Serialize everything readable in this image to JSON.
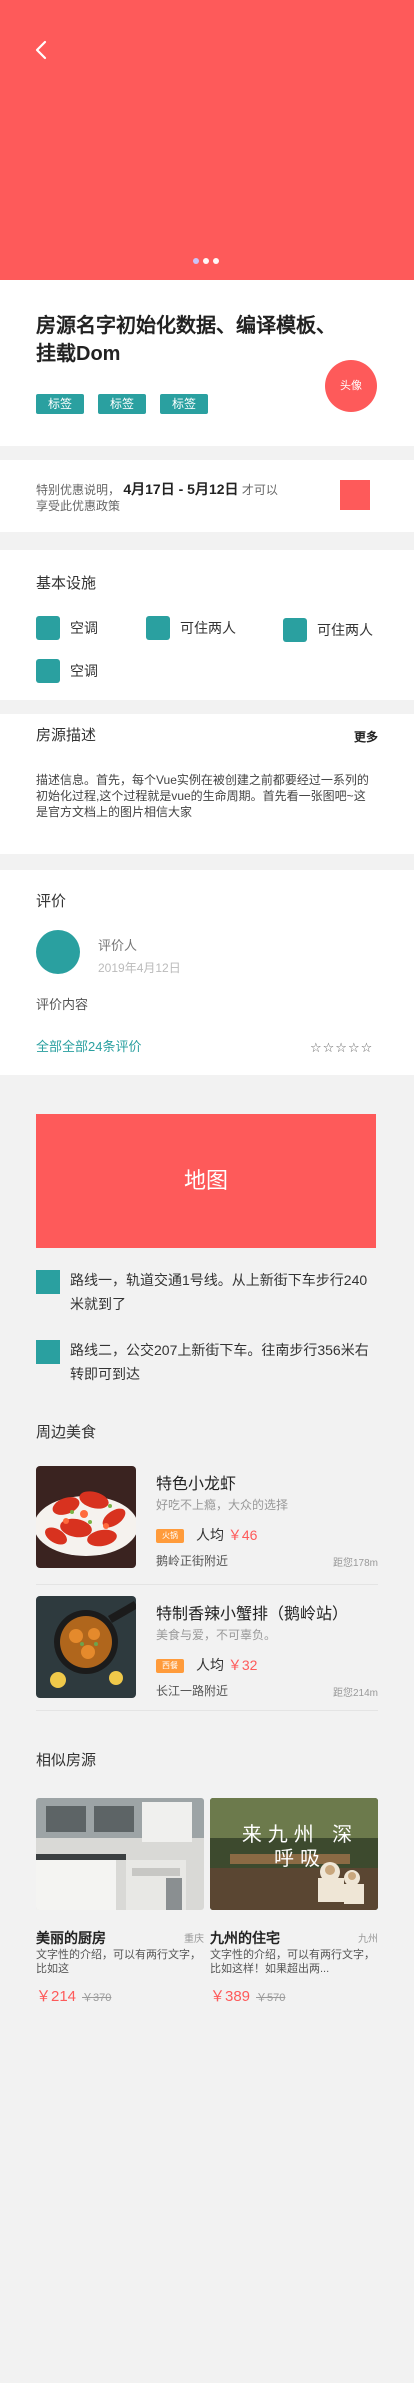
{
  "header": {
    "back_icon": "chevron-left-icon",
    "carousel": {
      "count": 3,
      "active": 0
    }
  },
  "room": {
    "title": "房源名字初始化数据、编译模板、挂载Dom",
    "tags": [
      "标签",
      "标签",
      "标签"
    ],
    "host_avatar_label": "头像"
  },
  "promo": {
    "prefix": "特别优惠说明，",
    "dates": "4月17日 - 5月12日",
    "suffix": "才可以享受此优惠政策"
  },
  "facilities": {
    "title": "基本设施",
    "items": [
      "空调",
      "可住两人",
      "可住两人",
      "空调"
    ]
  },
  "description": {
    "title": "房源描述",
    "more": "更多",
    "text": "描述信息。首先，每个Vue实例在被创建之前都要经过一系列的初始化过程,这个过程就是vue的生命周期。首先看一张图吧~这是官方文档上的图片相信大家"
  },
  "reviews": {
    "title": "评价",
    "reviewer": "评价人",
    "date": "2019年4月12日",
    "content": "评价内容",
    "all_link": "全部全部24条评价",
    "stars": "☆☆☆☆☆"
  },
  "map": {
    "label": "地图",
    "routes": [
      "路线一，轨道交通1号线。从上新街下车步行240米就到了",
      "路线二，公交207上新街下车。往南步行356米右转即可到达"
    ]
  },
  "food": {
    "title": "周边美食",
    "items": [
      {
        "name": "特色小龙虾",
        "sub": "好吃不上瘾，大众的选择",
        "badge": "火锅",
        "price_label": "人均",
        "price": "￥46",
        "addr": "鹅岭正街附近",
        "dist": "距您178m"
      },
      {
        "name": "特制香辣小蟹排（鹅岭站）",
        "sub": "美食与爱，不可辜负。",
        "badge": "西餐",
        "price_label": "人均",
        "price": "￥32",
        "addr": "长江一路附近",
        "dist": "距您214m"
      }
    ]
  },
  "similar": {
    "title": "相似房源",
    "items": [
      {
        "name": "美丽的厨房",
        "loc": "重庆",
        "desc": "文字性的介绍，可以有两行文字，比如这",
        "price": "￥214",
        "old": "￥370"
      },
      {
        "name": "九州的住宅",
        "loc": "九州",
        "desc": "文字性的介绍，可以有两行文字，比如这样！如果超出两...",
        "price": "￥389",
        "old": "￥570",
        "overlay": "来九州 深呼吸"
      }
    ]
  },
  "colors": {
    "accent": "#fe5a5a",
    "teal": "#2aa0a0",
    "orange": "#ff9b3b"
  }
}
